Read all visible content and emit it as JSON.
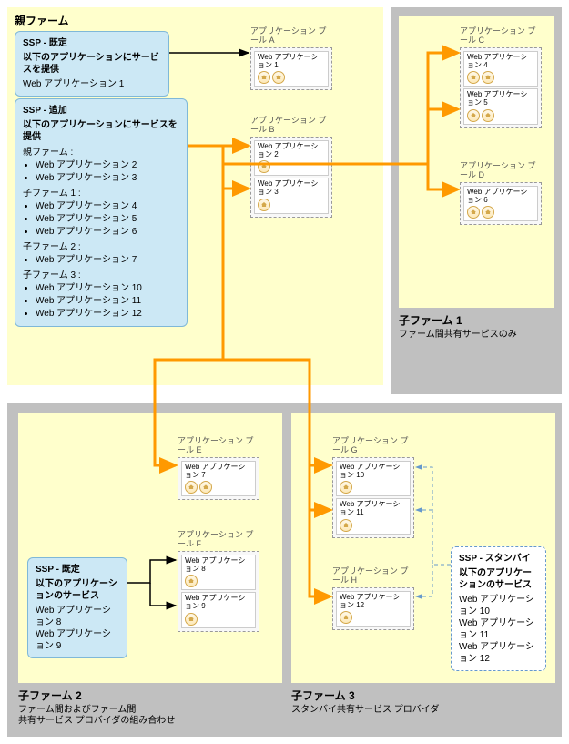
{
  "parent_farm": {
    "title": "親ファーム",
    "ssp_default": {
      "title": "SSP - 既定",
      "sub": "以下のアプリケーションにサービスを提供",
      "apps": [
        "Web アプリケーション 1"
      ]
    },
    "ssp_add": {
      "title": "SSP - 追加",
      "sub": "以下のアプリケーションにサービスを提供",
      "groups": [
        {
          "label": "親ファーム :",
          "apps": [
            "Web アプリケーション 2",
            "Web アプリケーション 3"
          ]
        },
        {
          "label": "子ファーム 1 :",
          "apps": [
            "Web アプリケーション 4",
            "Web アプリケーション 5",
            "Web アプリケーション 6"
          ]
        },
        {
          "label": "子ファーム 2 :",
          "apps": [
            "Web アプリケーション 7"
          ]
        },
        {
          "label": "子ファーム 3 :",
          "apps": [
            "Web アプリケーション 10",
            "Web アプリケーション 11",
            "Web アプリケーション 12"
          ]
        }
      ]
    },
    "pools": [
      {
        "name": "アプリケーション プール A",
        "apps": [
          {
            "label": "Web アプリケーション 1",
            "icons": 2
          }
        ]
      },
      {
        "name": "アプリケーション プール B",
        "apps": [
          {
            "label": "Web アプリケーション 2",
            "icons": 1
          },
          {
            "label": "Web アプリケーション 3",
            "icons": 1
          }
        ]
      }
    ]
  },
  "child1": {
    "title": "子ファーム 1",
    "sub": "ファーム間共有サービスのみ",
    "pools": [
      {
        "name": "アプリケーション プール C",
        "apps": [
          {
            "label": "Web アプリケーション 4",
            "icons": 2
          },
          {
            "label": "Web アプリケーション 5",
            "icons": 2
          }
        ]
      },
      {
        "name": "アプリケーション プール D",
        "apps": [
          {
            "label": "Web アプリケーション 6",
            "icons": 2
          }
        ]
      }
    ]
  },
  "child2": {
    "title": "子ファーム 2",
    "sub1": "ファーム間およびファーム間",
    "sub2": "共有サービス プロバイダの組み合わせ",
    "ssp": {
      "title": "SSP - 既定",
      "sub": "以下のアプリケーションのサービス",
      "apps": [
        "Web アプリケーション 8",
        "Web アプリケーション 9"
      ]
    },
    "pools": [
      {
        "name": "アプリケーション プール E",
        "apps": [
          {
            "label": "Web アプリケーション 7",
            "icons": 2
          }
        ]
      },
      {
        "name": "アプリケーション プール F",
        "apps": [
          {
            "label": "Web アプリケーション 8",
            "icons": 1
          },
          {
            "label": "Web アプリケーション 9",
            "icons": 1
          }
        ]
      }
    ]
  },
  "child3": {
    "title": "子ファーム 3",
    "sub": "スタンバイ共有サービス プロバイダ",
    "ssp": {
      "title": "SSP - スタンバイ",
      "sub": "以下のアプリケーションのサービス",
      "apps": [
        "Web アプリケーション 10",
        "Web アプリケーション 11",
        "Web アプリケーション 12"
      ]
    },
    "pools": [
      {
        "name": "アプリケーション プール G",
        "apps": [
          {
            "label": "Web アプリケーション 10",
            "icons": 1
          },
          {
            "label": "Web アプリケーション 11",
            "icons": 1
          }
        ]
      },
      {
        "name": "アプリケーション プール H",
        "apps": [
          {
            "label": "Web アプリケーション 12",
            "icons": 1
          }
        ]
      }
    ]
  }
}
